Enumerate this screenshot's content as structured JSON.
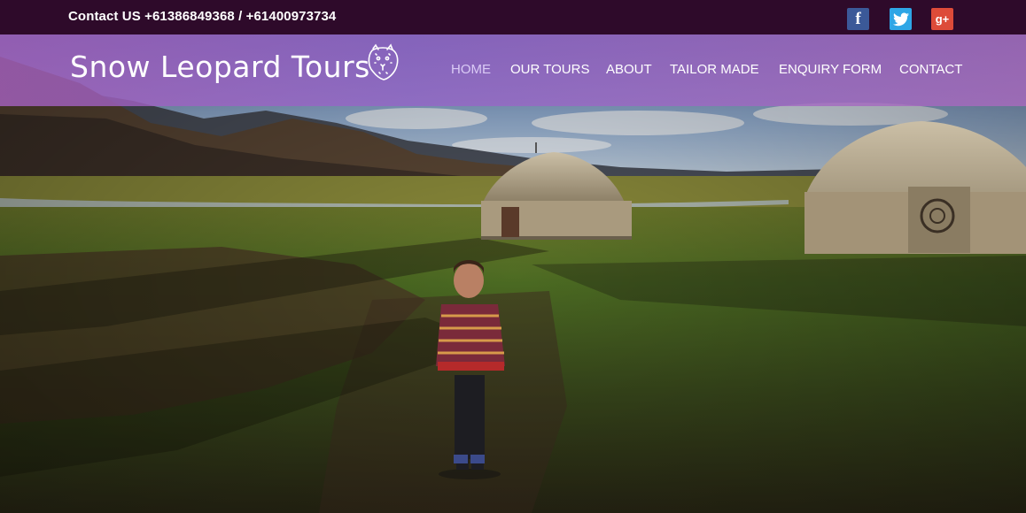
{
  "topbar": {
    "contact": "Contact US +61386849368 / +61400973734"
  },
  "social": [
    {
      "icon": "facebook-icon",
      "glyph": "f"
    },
    {
      "icon": "twitter-icon",
      "glyph": "🐦"
    },
    {
      "icon": "google-plus-icon",
      "glyph": "g+"
    }
  ],
  "brand": {
    "name": "Snow Leopard Tours"
  },
  "nav": {
    "items": [
      {
        "label": "HOME",
        "active": true
      },
      {
        "label": "OUR TOURS"
      },
      {
        "label": "ABOUT"
      },
      {
        "label": "TAILOR MADE"
      },
      {
        "label": "ENQUIRY FORM"
      },
      {
        "label": "CONTACT"
      }
    ]
  },
  "colors": {
    "topbar": "#2e0a2a",
    "nav_overlay": "#a460be",
    "facebook": "#3b5998",
    "twitter": "#2ea6e6",
    "google_plus": "#dd4b39"
  }
}
